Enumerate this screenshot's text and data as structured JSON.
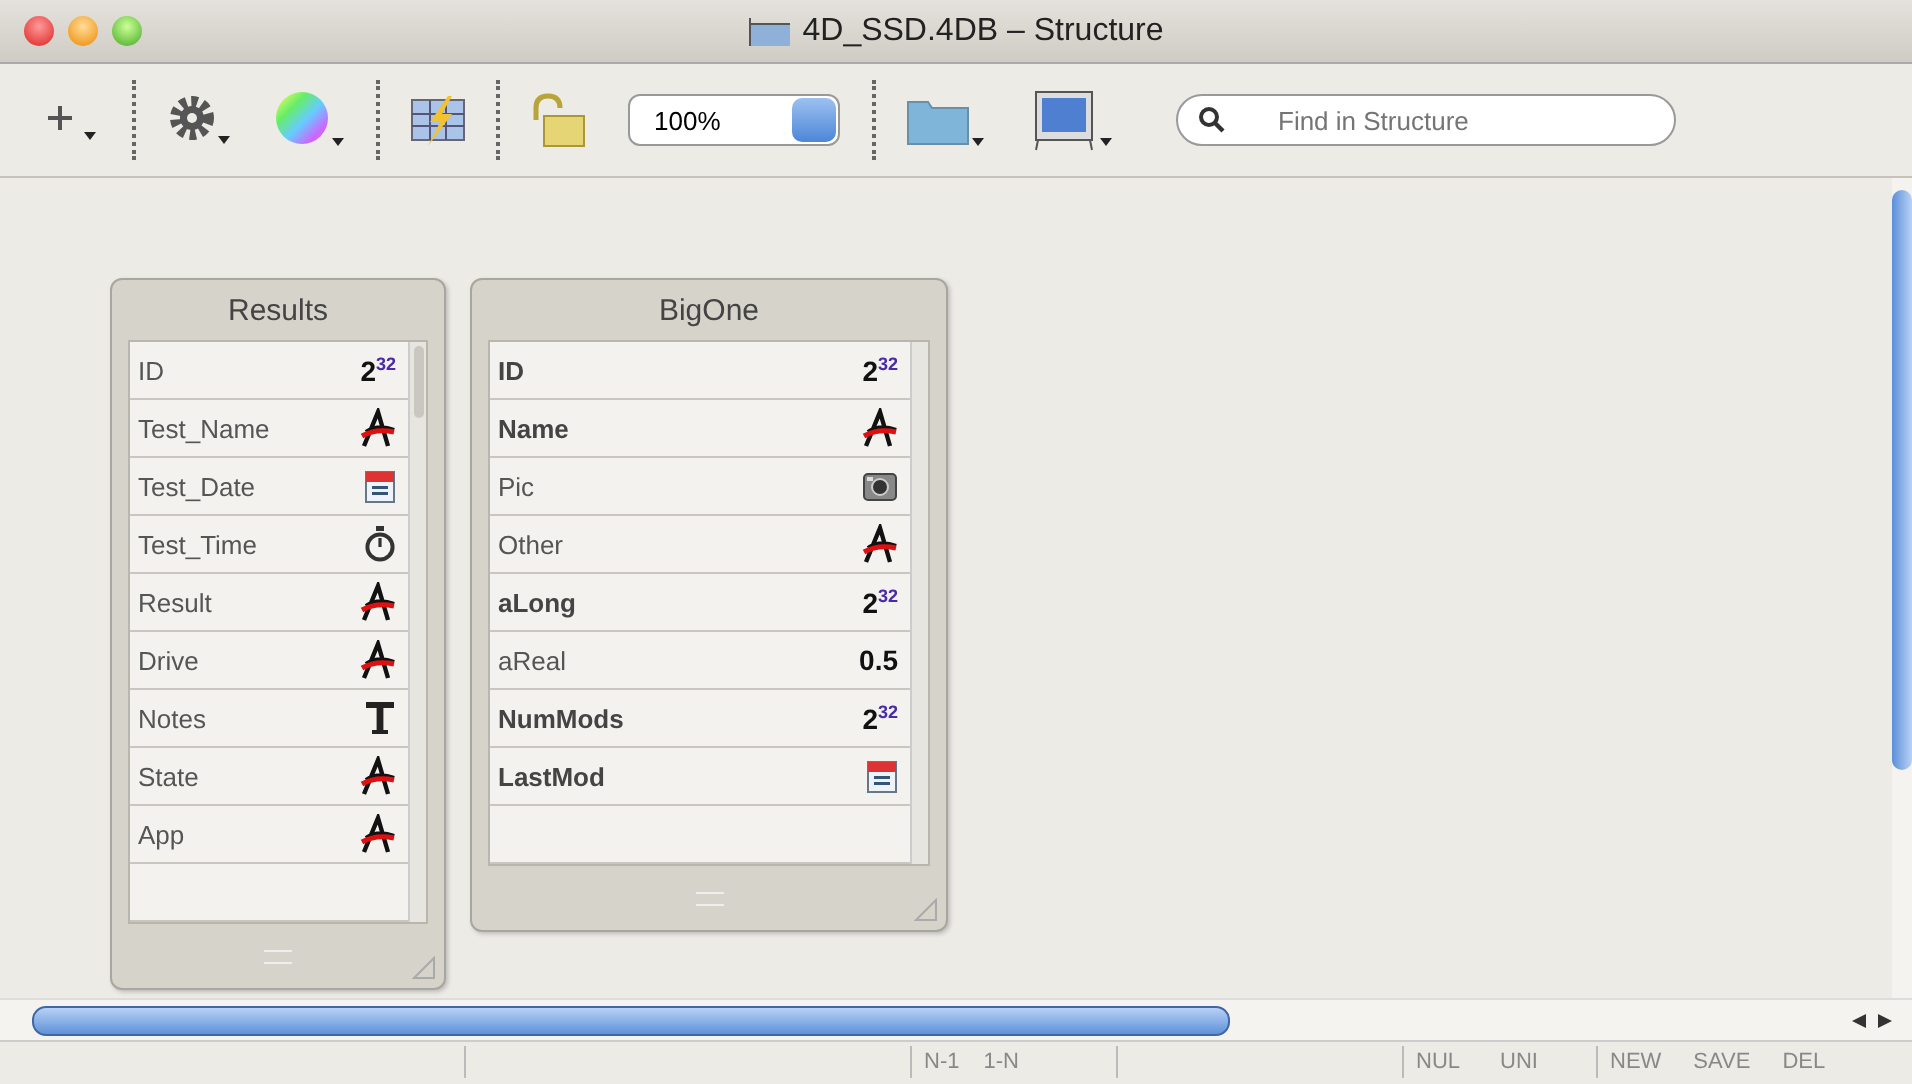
{
  "window": {
    "title": "4D_SSD.4DB – Structure"
  },
  "toolbar": {
    "zoom": "100%",
    "search": {
      "placeholder": "Find in Structure"
    }
  },
  "tables": [
    {
      "name": "Results",
      "fields": [
        {
          "name": "ID",
          "kind": "integer",
          "bold": false,
          "glyph": "2$^{32}$"
        },
        {
          "name": "Test_Name",
          "kind": "alpha",
          "bold": false
        },
        {
          "name": "Test_Date",
          "kind": "date",
          "bold": false
        },
        {
          "name": "Test_Time",
          "kind": "time",
          "bold": false
        },
        {
          "name": "Result",
          "kind": "alpha",
          "bold": false
        },
        {
          "name": "Drive",
          "kind": "alpha",
          "bold": false
        },
        {
          "name": "Notes",
          "kind": "text",
          "bold": false
        },
        {
          "name": "State",
          "kind": "alpha",
          "bold": false
        },
        {
          "name": "App",
          "kind": "alpha",
          "bold": false
        }
      ]
    },
    {
      "name": "BigOne",
      "fields": [
        {
          "name": "ID",
          "kind": "integer",
          "bold": true,
          "glyph": "2$^{32}$"
        },
        {
          "name": "Name",
          "kind": "alpha",
          "bold": true
        },
        {
          "name": "Pic",
          "kind": "picture",
          "bold": false
        },
        {
          "name": "Other",
          "kind": "alpha",
          "bold": false
        },
        {
          "name": "aLong",
          "kind": "integer",
          "bold": true,
          "glyph": "2$^{32}$"
        },
        {
          "name": "aReal",
          "kind": "real",
          "bold": false,
          "glyph": "0.5"
        },
        {
          "name": "NumMods",
          "kind": "integer",
          "bold": true,
          "glyph": "2$^{32}$"
        },
        {
          "name": "LastMod",
          "kind": "date",
          "bold": true
        }
      ]
    }
  ],
  "status_bar": {
    "relations": [
      "N-1",
      "1-N"
    ],
    "flags": [
      "NUL",
      "UNI"
    ],
    "actions": [
      "NEW",
      "SAVE",
      "DEL"
    ]
  }
}
